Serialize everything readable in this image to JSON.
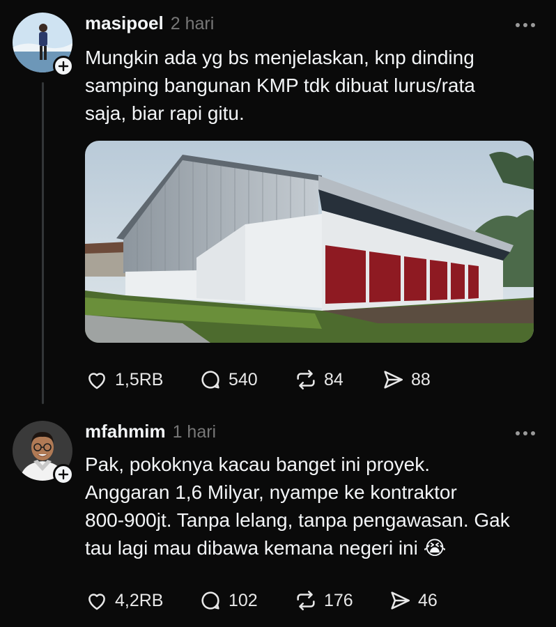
{
  "posts": [
    {
      "username": "masipoel",
      "time": "2 hari",
      "text": "Mungkin ada yg bs menjelaskan, knp dinding\nsamping bangunan KMP tdk dibuat lurus/rata\nsaja, biar rapi gitu.",
      "has_image": true,
      "stats": {
        "likes": "1,5RB",
        "replies": "540",
        "reposts": "84",
        "shares": "88"
      }
    },
    {
      "username": "mfahmim",
      "time": "1 hari",
      "text": "Pak, pokoknya kacau banget ini proyek.\nAnggaran 1,6 Milyar, nyampe ke kontraktor\n800-900jt. Tanpa lelang, tanpa pengawasan. Gak\ntau lagi mau dibawa kemana negeri ini",
      "emoji": "😭",
      "stats": {
        "likes": "4,2RB",
        "replies": "102",
        "reposts": "176",
        "shares": "46"
      }
    }
  ],
  "icons": {
    "like": "heart-icon",
    "reply": "comment-bubble-icon",
    "repost": "repost-icon",
    "share": "send-icon",
    "follow": "plus-icon",
    "more": "more-dots-icon"
  },
  "colors": {
    "background": "#0a0a0a",
    "text": "#f3f5f7",
    "muted": "#777777",
    "thread_line": "#333638"
  }
}
